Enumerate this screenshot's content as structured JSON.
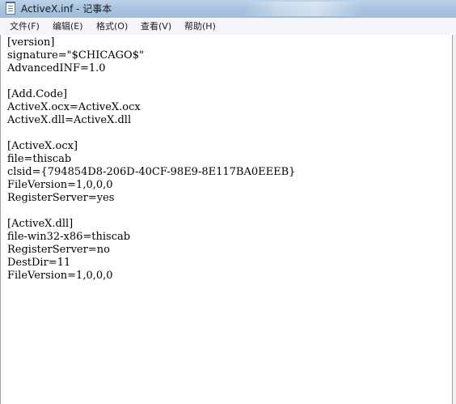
{
  "window": {
    "title": "ActiveX.inf - 记事本",
    "icon": "notepad-icon"
  },
  "menu": [
    {
      "label": "文件(F)"
    },
    {
      "label": "编辑(E)"
    },
    {
      "label": "格式(O)"
    },
    {
      "label": "查看(V)"
    },
    {
      "label": "帮助(H)"
    }
  ],
  "editor": {
    "lines": [
      "[version]",
      "signature=\"$CHICAGO$\"",
      "AdvancedINF=1.0",
      "",
      "[Add.Code]",
      "ActiveX.ocx=ActiveX.ocx",
      "ActiveX.dll=ActiveX.dll",
      "",
      "[ActiveX.ocx]",
      "file=thiscab",
      "clsid={794854D8-206D-40CF-98E9-8E117BA0EEEB}",
      "FileVersion=1,0,0,0",
      "RegisterServer=yes",
      "",
      "[ActiveX.dll]",
      "file-win32-x86=thiscab",
      "RegisterServer=no",
      "DestDir=11",
      "FileVersion=1,0,0,0"
    ]
  }
}
